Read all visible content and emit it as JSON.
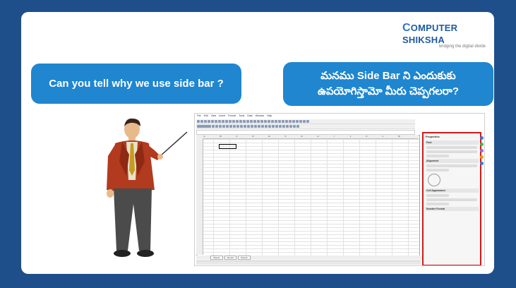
{
  "logo": {
    "brand_c": "C",
    "brand_rest": "OMPUTER SHIKSHA",
    "tagline": "bridging the digital divide"
  },
  "question_en": "Can you tell why we use side bar ?",
  "question_te": {
    "line1": "మనము Side Bar ని ఎందుకుకు",
    "line2": "ఉపయోగిస్తామో మీరు చెప్పగలరా?"
  },
  "spreadsheet": {
    "menu": [
      "File",
      "Edit",
      "View",
      "Insert",
      "Format",
      "Tools",
      "Data",
      "Window",
      "Help"
    ],
    "columns": [
      "A",
      "B",
      "C",
      "D",
      "E",
      "F",
      "G",
      "H",
      "I",
      "J",
      "K",
      "L",
      "M"
    ],
    "sheets": [
      "Sheet1",
      "Sheet2",
      "Sheet3"
    ],
    "sidebar": {
      "title": "Properties",
      "sections": [
        "Font",
        "Alignment",
        "Cell Appearance",
        "Number Format"
      ]
    }
  },
  "colors": {
    "background": "#1f4f8a",
    "bubble": "#1f86cf",
    "sidebar_highlight": "#d11a1a"
  }
}
